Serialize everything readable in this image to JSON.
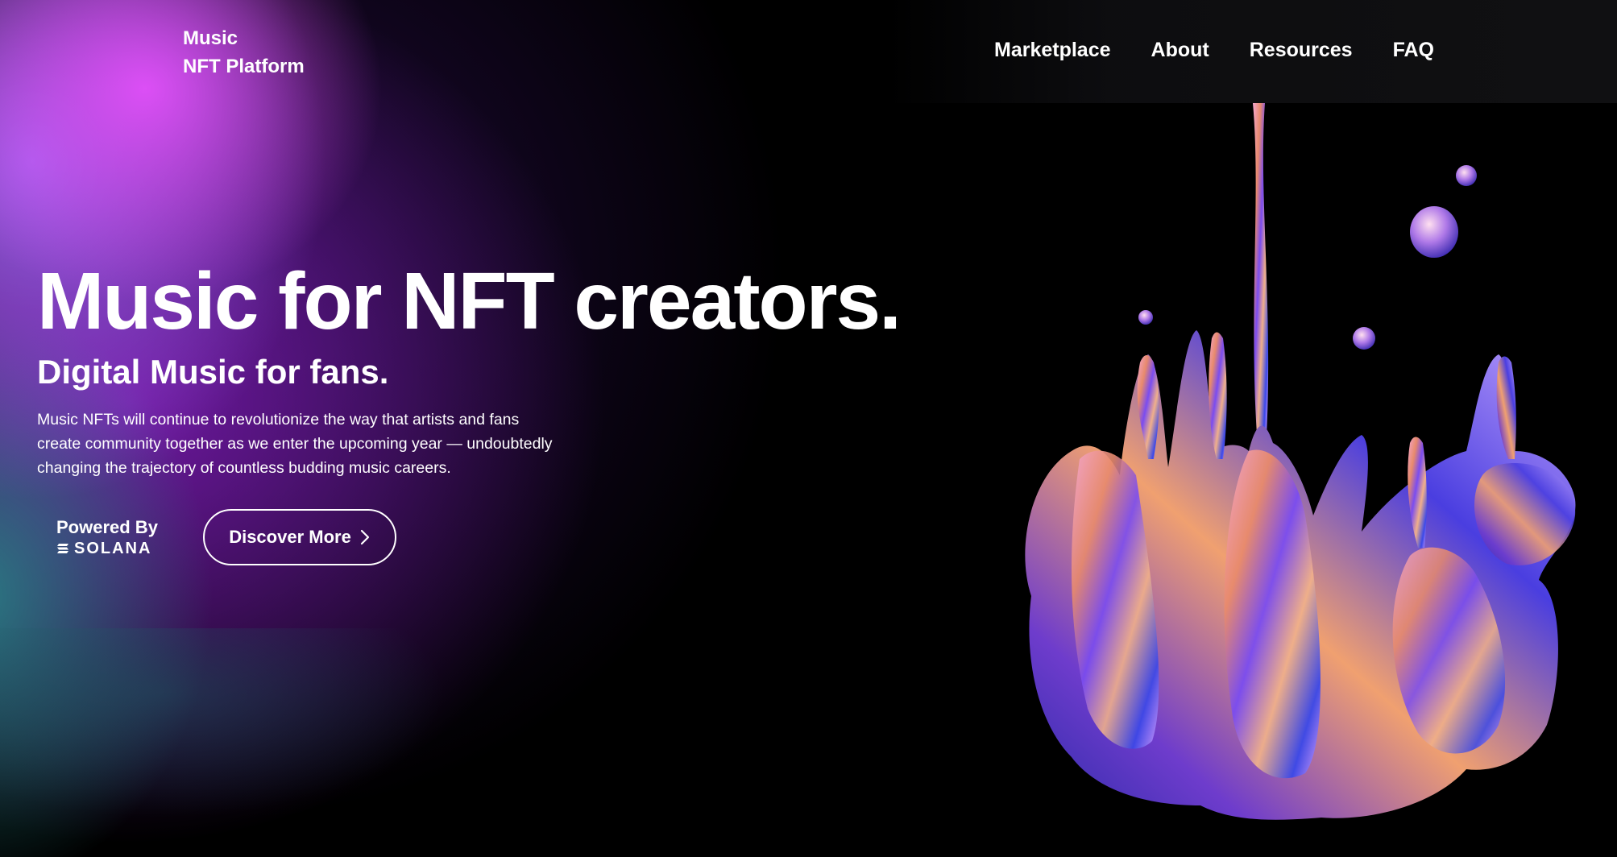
{
  "header": {
    "logo_line1": "Music",
    "logo_line2": "NFT Platform",
    "nav": [
      {
        "label": "Marketplace"
      },
      {
        "label": "About"
      },
      {
        "label": "Resources"
      },
      {
        "label": "FAQ"
      }
    ]
  },
  "hero": {
    "title": "Music for NFT creators.",
    "subtitle": "Digital Music for fans.",
    "description": "Music NFTs will continue to revolutionize the way that artists and fans create community together as we enter the upcoming year — undoubtedly changing the trajectory of countless budding music careers."
  },
  "cta": {
    "powered_by": "Powered By",
    "brand": "SOLANA",
    "discover_label": "Discover More"
  },
  "icons": {
    "solana": "solana-logo-icon",
    "chevron": "chevron-right-icon"
  },
  "colors": {
    "accent_pink": "#e250fa",
    "accent_purple": "#8c1ec8",
    "accent_teal": "#288c8c",
    "background": "#000000",
    "text": "#ffffff"
  }
}
